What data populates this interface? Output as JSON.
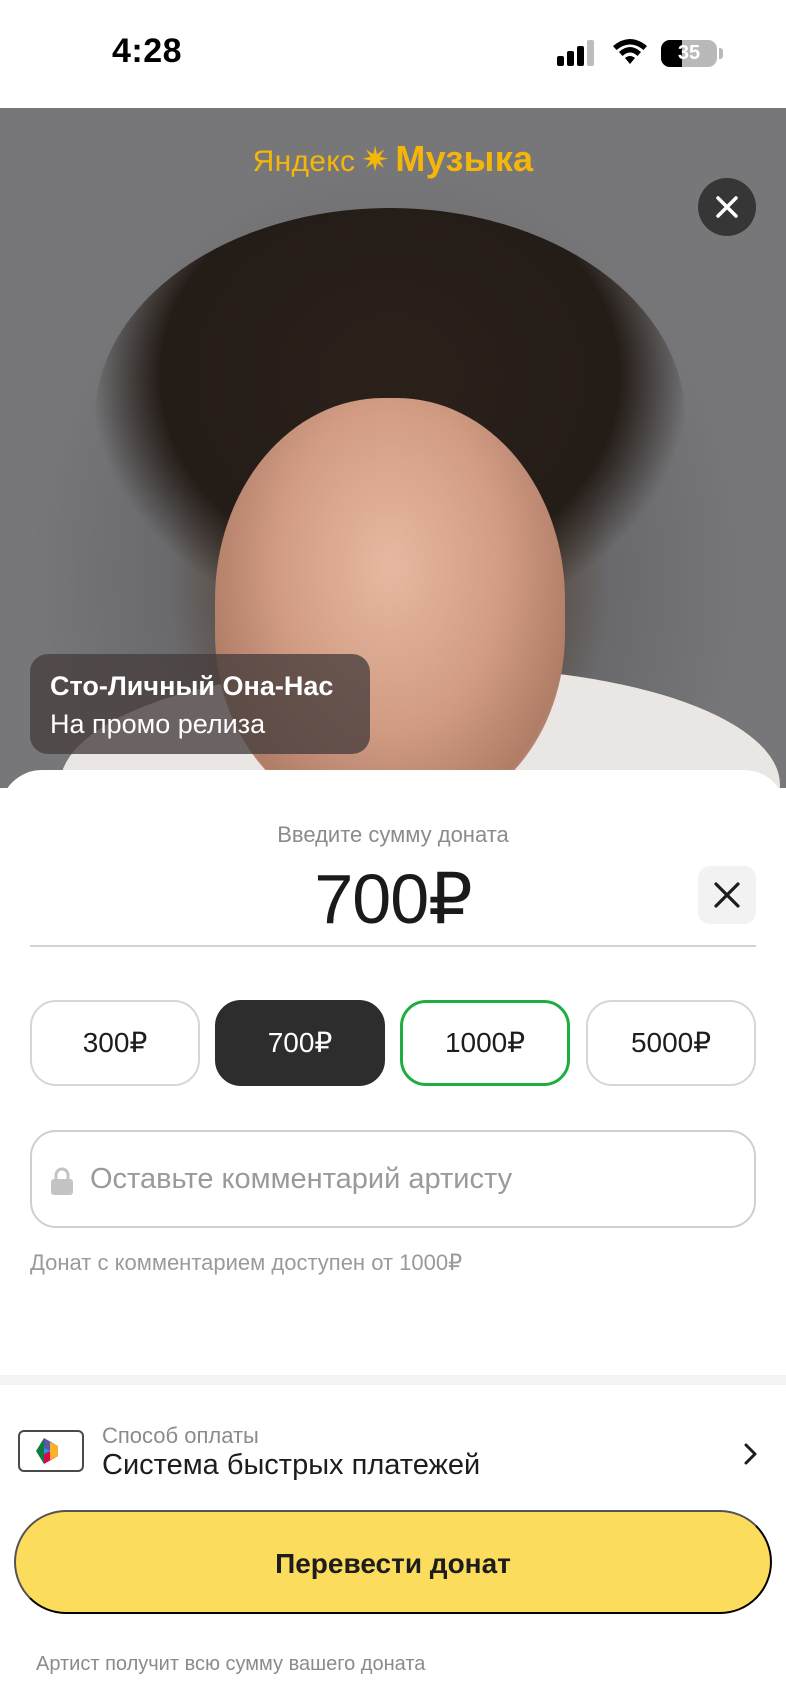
{
  "status_bar": {
    "time": "4:28",
    "battery": "35"
  },
  "hero": {
    "brand_part1": "Яндекс",
    "brand_part2": "Музыка",
    "artist_name": "Сто-Личный Она-Нас",
    "artist_subtitle": "На промо релиза"
  },
  "donation": {
    "amount_label": "Введите сумму доната",
    "amount": "700₽",
    "presets": [
      "300₽",
      "700₽",
      "1000₽",
      "5000₽"
    ],
    "selected_preset": "700₽",
    "comment_placeholder": "Оставьте комментарий артисту",
    "comment_hint": "Донат с комментарием доступен от 1000₽"
  },
  "payment": {
    "method_label": "Способ оплаты",
    "method_value": "Система быстрых платежей",
    "submit_label": "Перевести донат",
    "footer_note": "Артист получит всю сумму вашего доната"
  },
  "colors": {
    "brand_yellow": "#f5b60a",
    "cta_yellow": "#fcdc5c",
    "selected_chip": "#2d2d2d",
    "highlight_chip": "#1eae3f"
  }
}
